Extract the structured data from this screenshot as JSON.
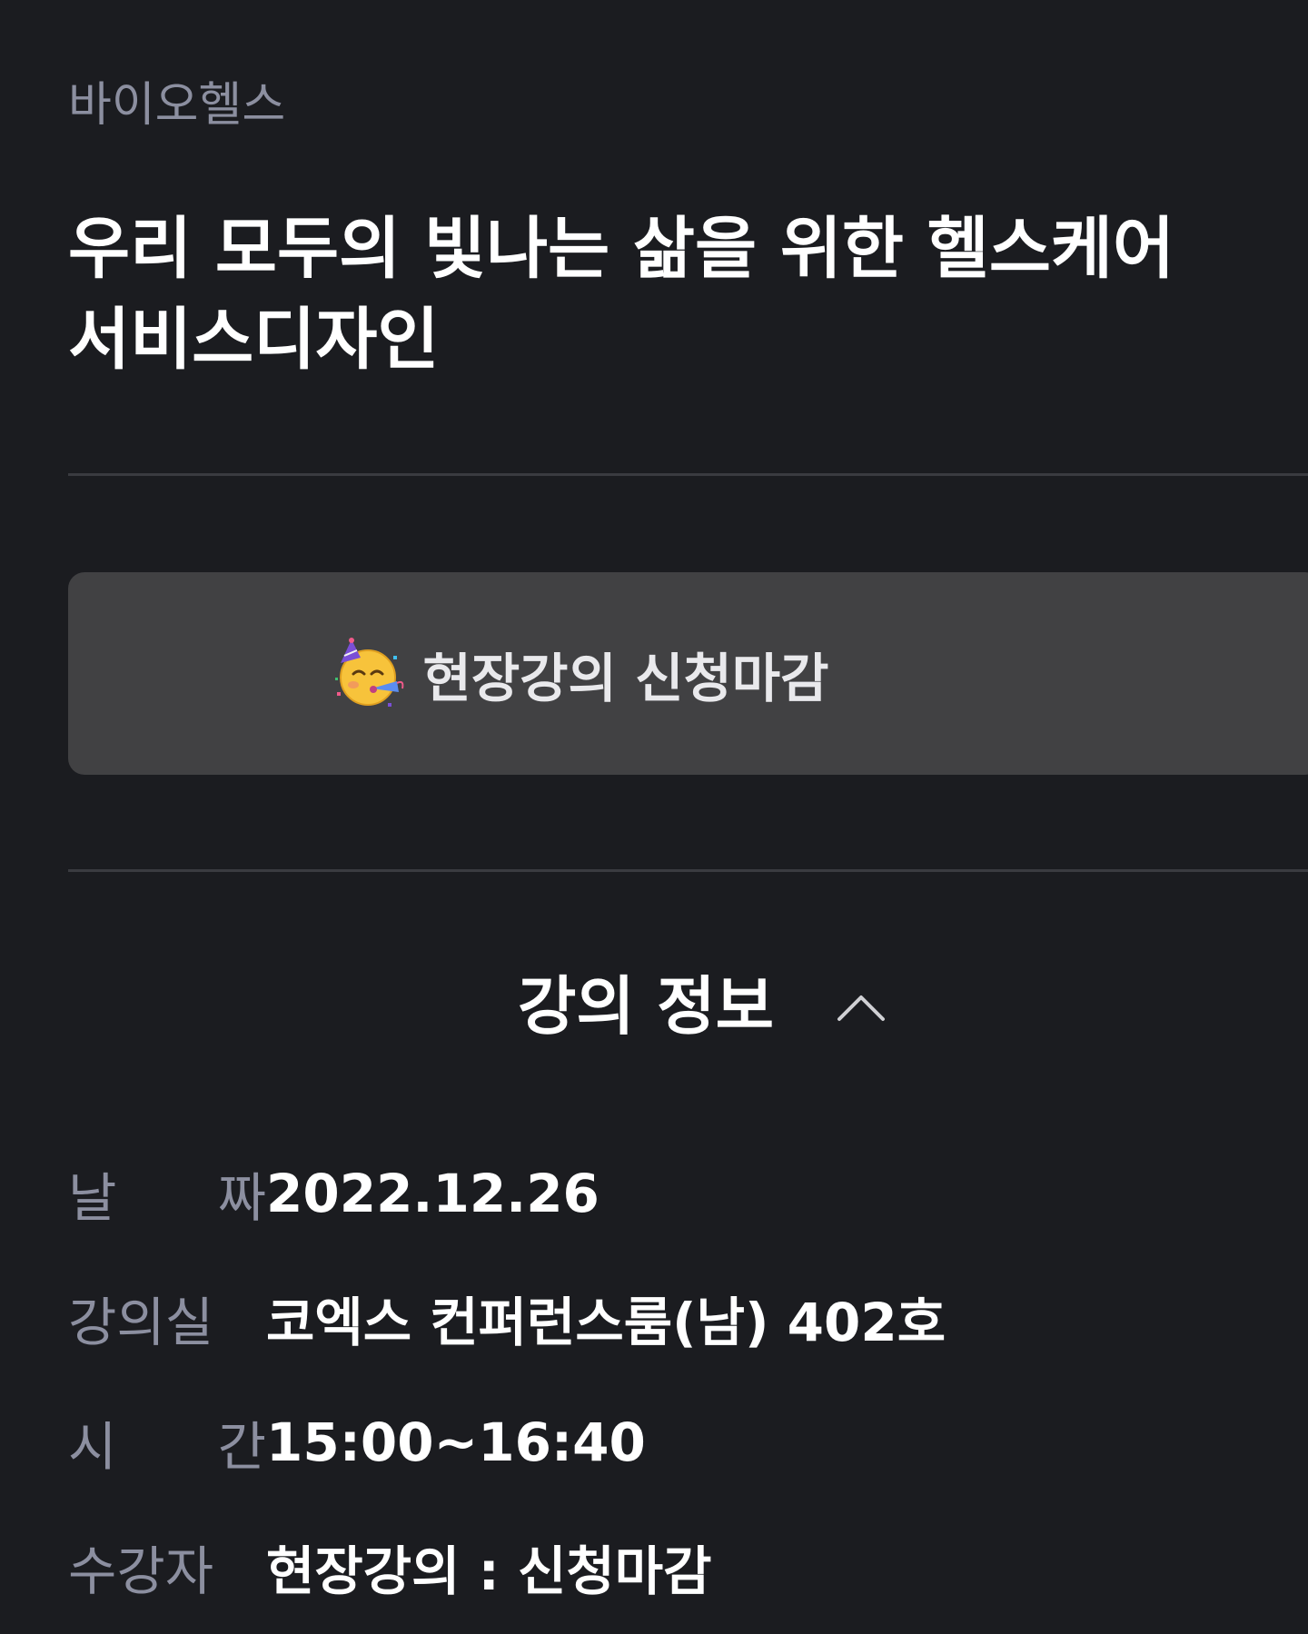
{
  "course": {
    "category": "바이오헬스",
    "title_line1": "우리 모두의 빛나는 삶을 위한 헬스케어",
    "title_line2": "서비스디자인"
  },
  "status_button": {
    "emoji_icon": "partying-face-icon",
    "label": "현장강의 신청마감"
  },
  "section": {
    "title": "강의 정보",
    "toggle_icon": "chevron-up-icon"
  },
  "info": {
    "date_label_1": "날",
    "date_label_2": "짜",
    "date_value": "2022.12.26",
    "room_label": "강의실",
    "room_value": "코엑스 컨퍼런스룸(남) 402호",
    "time_label_1": "시",
    "time_label_2": "간",
    "time_value": "15:00~16:40",
    "attendee_label": "수강자",
    "attendee_value": "현장강의 : 신청마감"
  },
  "colors": {
    "background": "#1b1c20",
    "muted_text": "#8c8fa0",
    "button_bg": "#414143",
    "divider": "#3a3b40"
  }
}
